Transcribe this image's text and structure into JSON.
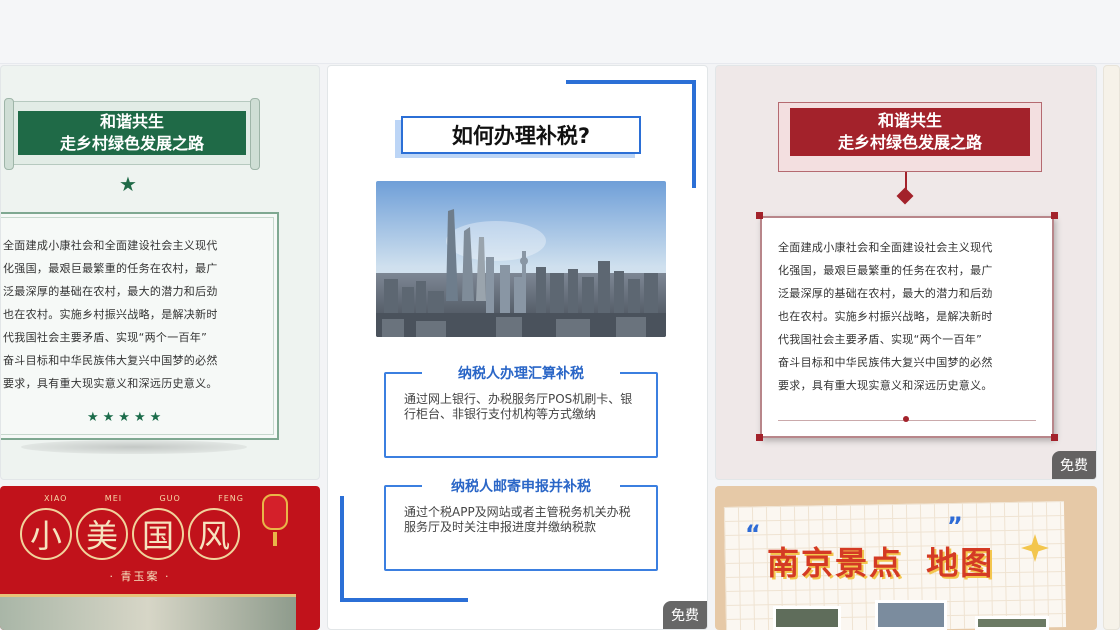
{
  "cards": {
    "green": {
      "title_line1": "和谐共生",
      "title_line2": "走乡村绿色发展之路",
      "paragraph": "全面建成小康社会和全面建设社会主义现代\n化强国，最艰巨最繁重的任务在农村，最广\n泛最深厚的基础在农村，最大的潜力和后劲\n也在农村。实施乡村振兴战略，是解决新时\n代我国社会主要矛盾、实现“两个一百年”\n奋斗目标和中华民族伟大复兴中国梦的必然\n要求，具有重大现实意义和深远历史意义。",
      "stars": "★★★★★",
      "accent": "#1f6a47"
    },
    "tax": {
      "title": "如何办理补税?",
      "section1_title": "纳税人办理汇算补税",
      "section1_body": "通过网上银行、办税服务厅POS机刷卡、银行柜台、非银行支付机构等方式缴纳",
      "section2_title": "纳税人邮寄申报并补税",
      "section2_body": "通过个税APP及网站或者主管税务机关办税服务厅及时关注申报进度并缴纳税款",
      "badge": "免费",
      "accent": "#2b6fd6"
    },
    "red": {
      "title_line1": "和谐共生",
      "title_line2": "走乡村绿色发展之路",
      "paragraph": "全面建成小康社会和全面建设社会主义现代\n化强国，最艰巨最繁重的任务在农村，最广\n泛最深厚的基础在农村，最大的潜力和后劲\n也在农村。实施乡村振兴战略，是解决新时\n代我国社会主要矛盾、实现“两个一百年”\n奋斗目标和中华民族伟大复兴中国梦的必然\n要求，具有重大现实意义和深远历史意义。",
      "badge": "免费",
      "accent": "#a3222b"
    },
    "style": {
      "labels": [
        "XIAO",
        "MEI",
        "GUO",
        "FENG"
      ],
      "chars": [
        "小",
        "美",
        "国",
        "风"
      ],
      "subtitle": "· 青玉案 ·"
    },
    "map": {
      "title_part1": "南京景点",
      "title_part2": "地图"
    }
  }
}
